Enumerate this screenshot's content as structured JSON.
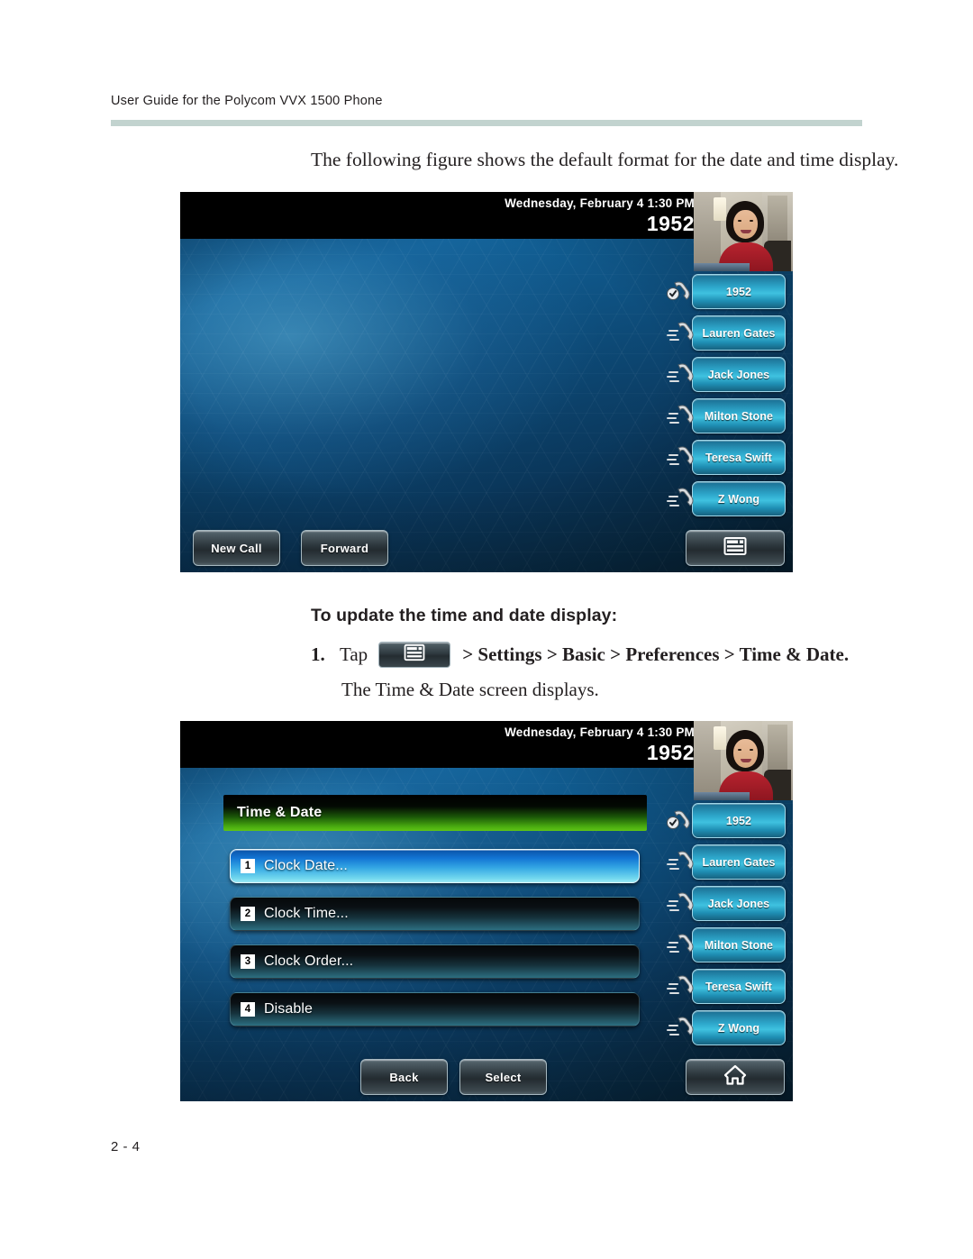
{
  "document": {
    "header": "User Guide for the Polycom VVX 1500 Phone",
    "page_number": "2 - 4",
    "intro_line": "The following figure shows the default format for the date and time display.",
    "section_heading": "To update the time and date display:",
    "step": {
      "number": "1.",
      "tap_label": "Tap",
      "menu_key_icon": "menu-window-icon",
      "path": "> Settings > Basic > Preferences > Time & Date."
    },
    "step_result": "The Time & Date screen displays."
  },
  "phone_home": {
    "status": {
      "datetime": "Wednesday, February 4  1:30 PM",
      "extension": "1952"
    },
    "video_self_view": "video-self-view",
    "line_keys": [
      {
        "label": "1952",
        "icon": "handset-registered-icon"
      },
      {
        "label": "Lauren Gates",
        "icon": "handset-icon"
      },
      {
        "label": "Jack Jones",
        "icon": "handset-icon"
      },
      {
        "label": "Milton Stone",
        "icon": "handset-icon"
      },
      {
        "label": "Teresa Swift",
        "icon": "handset-icon"
      },
      {
        "label": "Z Wong",
        "icon": "handset-icon"
      }
    ],
    "softkeys": {
      "left": "New Call",
      "middle": "Forward",
      "right_icon": "menu-window-icon"
    }
  },
  "phone_menu": {
    "status": {
      "datetime": "Wednesday, February 4  1:30 PM",
      "extension": "1952"
    },
    "video_self_view": "video-self-view",
    "title": "Time & Date",
    "items": [
      {
        "index": "1",
        "label": "Clock Date...",
        "selected": true
      },
      {
        "index": "2",
        "label": "Clock Time...",
        "selected": false
      },
      {
        "index": "3",
        "label": "Clock Order...",
        "selected": false
      },
      {
        "index": "4",
        "label": "Disable",
        "selected": false
      }
    ],
    "line_keys": [
      {
        "label": "1952",
        "icon": "handset-registered-icon"
      },
      {
        "label": "Lauren Gates",
        "icon": "handset-icon"
      },
      {
        "label": "Jack Jones",
        "icon": "handset-icon"
      },
      {
        "label": "Milton Stone",
        "icon": "handset-icon"
      },
      {
        "label": "Teresa Swift",
        "icon": "handset-icon"
      },
      {
        "label": "Z Wong",
        "icon": "handset-icon"
      }
    ],
    "softkeys": {
      "left": "Back",
      "middle": "Select",
      "right_icon": "home-icon"
    }
  },
  "colors": {
    "header_rule": "#c2d3cf",
    "text": "#231f20",
    "menu_title_green": "#49ab10",
    "selected_item_blue": "#1375d4",
    "line_key_cyan": "#2ea8cc"
  }
}
